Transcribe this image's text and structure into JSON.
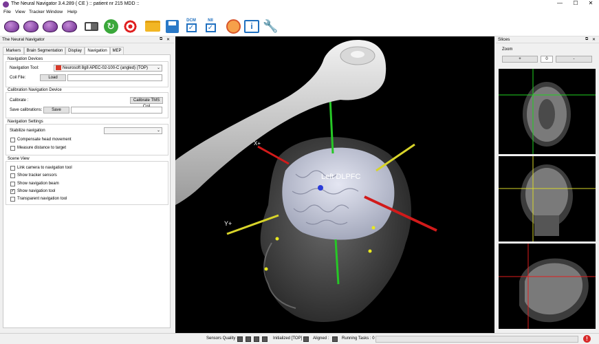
{
  "window": {
    "title": "The Neural Navigator 3.4.289 ( CE )  ::  patient nr 215 MDD ::",
    "minimize": "—",
    "maximize": "☐",
    "close": "✕"
  },
  "menu": [
    "File",
    "View",
    "Tracker",
    "Window",
    "Help"
  ],
  "toolbar": {
    "dcm_label": "DCM",
    "nii_label": "NII"
  },
  "left_panel": {
    "title": "The Neural Navigator",
    "tabs": [
      "Markers",
      "Brain Segmentation",
      "Display",
      "Navigation",
      "MEP"
    ],
    "active_tab": "Navigation",
    "nav_devices": {
      "title": "Navigation Devices",
      "tool_label": "Navigation Tool:",
      "tool_value": "Neurosoft 8g8 APEC-02-100-C (angled) (TOP)",
      "coil_label": "Coil File:",
      "load_button": "Load",
      "coil_value": ""
    },
    "calibration": {
      "title": "Calibration Navigation Device",
      "calibrate_label": "Calibrate :",
      "calibrate_button": "Calibrate TMS Coil",
      "save_label": "Save calibrations:",
      "save_button": "Save",
      "save_value": ""
    },
    "nav_settings": {
      "title": "Navigation Settings",
      "stabilize_label": "Stabilize navigation",
      "stabilize_value": "",
      "compensate_label": "Compensate head movement",
      "measure_label": "Measure distance to target"
    },
    "scene_view": {
      "title": "Scene View",
      "items": [
        {
          "label": "Link camera to navigation tool",
          "checked": false
        },
        {
          "label": "Show tracker sensors",
          "checked": false
        },
        {
          "label": "Show navigation beam",
          "checked": false
        },
        {
          "label": "Show navigation tool",
          "checked": true
        },
        {
          "label": "Transparent navigation tool",
          "checked": false
        }
      ]
    }
  },
  "viewport": {
    "target_label": "Left DLPFC",
    "x_axis_label": "X+",
    "y_axis_label": "Y+"
  },
  "slices_panel": {
    "title": "Slices",
    "zoom_label": "Zoom",
    "plus_button": "+",
    "zoom_value": "0",
    "minus_button": "-"
  },
  "status": {
    "sensors_label": "Sensors Quality :",
    "initialized_label": "Initialized [TOP]",
    "aligned_label": "Aligned :",
    "tasks_label": "Running Tasks : 0",
    "alert_glyph": "!"
  },
  "colors": {
    "x_axis": "#d11a1a",
    "y_axis": "#d8d42a",
    "z_axis": "#26c826",
    "target": "#2b3cd8",
    "crosshair_green": "#1fd31f",
    "crosshair_yellow": "#d8d82a",
    "crosshair_red": "#e01c1c"
  }
}
